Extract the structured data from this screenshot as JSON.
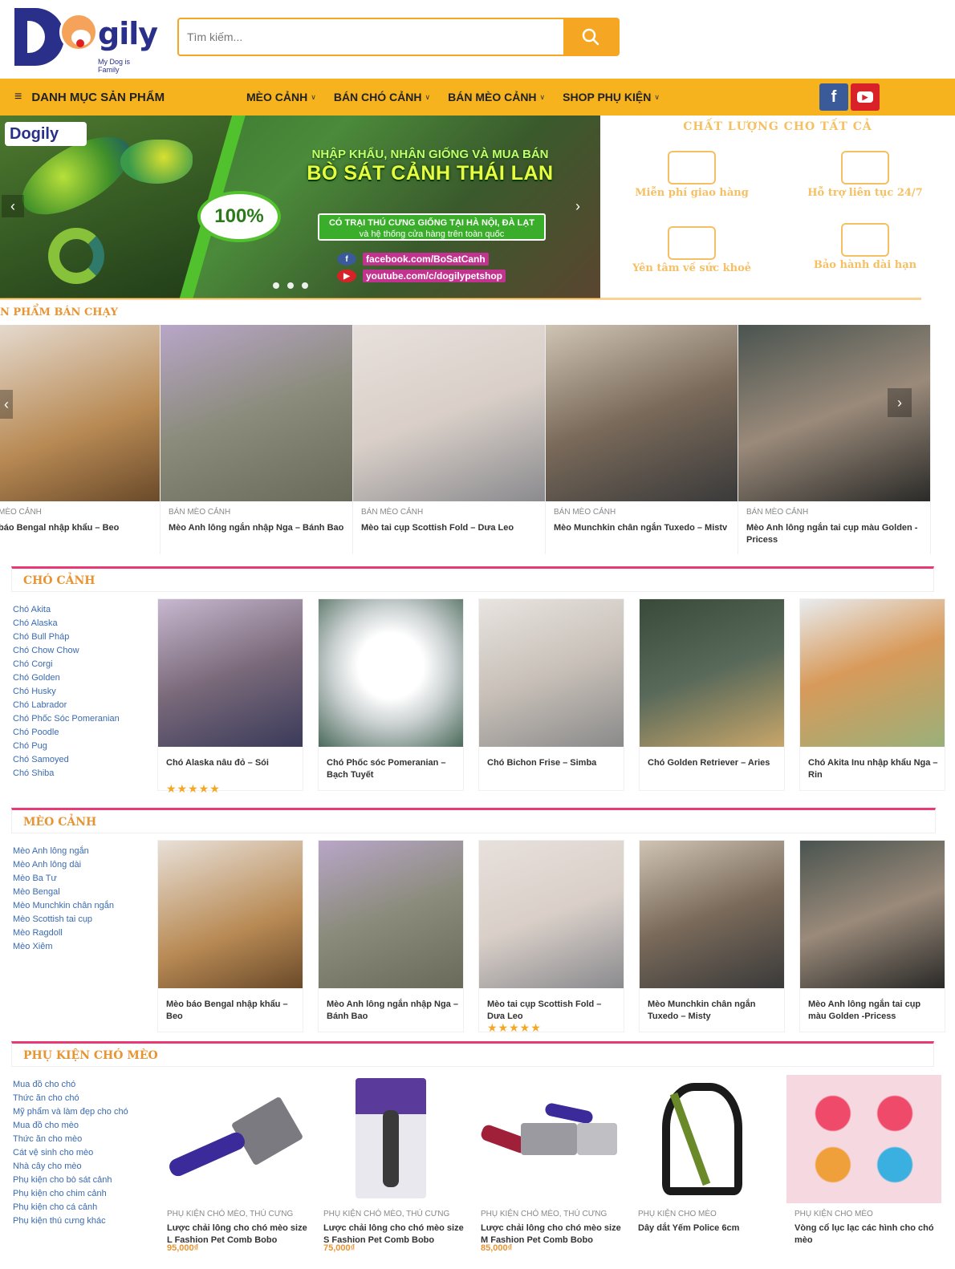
{
  "colors": {
    "accent": "#f7b31e",
    "section_title": "#e89432",
    "section_rule": "#e83a74",
    "link": "#3a6ab0",
    "brand": "#2a2f8a"
  },
  "logo": {
    "word": "gily",
    "tagline": "My Dog is Family"
  },
  "search": {
    "placeholder": "Tìm kiếm...",
    "icon": "search-icon"
  },
  "nav": {
    "category_label": "DANH MỤC SẢN PHẨM",
    "items": [
      {
        "label": "MÈO CẢNH"
      },
      {
        "label": "BÁN CHÓ CẢNH"
      },
      {
        "label": "BÁN MÈO CẢNH"
      },
      {
        "label": "SHOP PHỤ KIỆN"
      }
    ],
    "social": [
      {
        "icon": "facebook-icon",
        "glyph": "f"
      },
      {
        "icon": "youtube-icon",
        "glyph": "▶"
      }
    ]
  },
  "banner": {
    "logo": "Dogily",
    "line1": "NHẬP KHẨU, NHÂN GIỐNG VÀ MUA BÁN",
    "line2": "BÒ SÁT CẢNH THÁI LAN",
    "badge": "100%",
    "box_line1": "CÓ TRẠI THÚ CƯNG GIỐNG TẠI HÀ NỘI, ĐÀ LẠT",
    "box_line2": "và hệ thống cửa hàng trên toàn quốc",
    "facebook": "facebook.com/BoSatCanh",
    "youtube": "youtube.com/c/dogilypetshop",
    "slide_count": 3
  },
  "features": {
    "title": "CHẤT LƯỢNG CHO TẤT CẢ",
    "items": [
      {
        "label": "Miễn phí giao hàng",
        "icon": "rocket-icon"
      },
      {
        "label": "Hỗ trợ liên tục 24/7",
        "icon": "support-agent-icon"
      },
      {
        "label": "Yên tâm về sức khoẻ",
        "icon": "network-icon"
      },
      {
        "label": "Bảo hành dài hạn",
        "icon": "megaphone-icon"
      }
    ]
  },
  "best_sellers": {
    "title": "SẢN PHẨM BÁN CHẠY",
    "title_visible": "N PHẨM BÁN CHẠY",
    "items": [
      {
        "category": "MÈO CẢNH",
        "name": "báo Bengal nhập khẩu – Beo",
        "color": "#b88a54"
      },
      {
        "category": "BÁN MÈO CẢNH",
        "name": "Mèo Anh lông ngắn nhập Nga – Bánh Bao",
        "color": "#8a8b7a"
      },
      {
        "category": "BÁN MÈO CẢNH",
        "name": "Mèo tai cụp Scottish Fold – Dưa Leo",
        "color": "#d9cfc8"
      },
      {
        "category": "BÁN MÈO CẢNH",
        "name": "Mèo Munchkin chân ngắn Tuxedo – Mistv",
        "color": "#7a6a5a"
      },
      {
        "category": "BÁN MÈO CẢNH",
        "name": "Mèo Anh lông ngắn tai cụp màu Golden -Pricess",
        "color": "#9a8a7a"
      }
    ]
  },
  "dogs": {
    "title": "CHÓ CẢNH",
    "links": [
      "Chó Akita",
      "Chó Alaska",
      "Chó Bull Pháp",
      "Chó Chow Chow",
      "Chó Corgi",
      "Chó Golden",
      "Chó Husky",
      "Chó Labrador",
      "Chó Phốc Sóc Pomeranian",
      "Chó Poodle",
      "Chó Pug",
      "Chó Samoyed",
      "Chó Shiba"
    ],
    "products": [
      {
        "name": "Chó Alaska nâu đỏ – Sói",
        "stars": "★★★★★",
        "color": "#7a6a7a"
      },
      {
        "name": "Chó Phốc sóc Pomeranian – Bạch Tuyết",
        "stars": "",
        "color": "#c9cfd0"
      },
      {
        "name": "Chó Bichon Frise – Simba",
        "stars": "",
        "color": "#c8c0b8"
      },
      {
        "name": "Chó Golden Retriever – Aries",
        "stars": "",
        "color": "#5a6a5a"
      },
      {
        "name": "Chó Akita Inu nhập khẩu Nga – Rin",
        "stars": "",
        "color": "#9ab07a"
      }
    ]
  },
  "cats": {
    "title": "MÈO CẢNH",
    "links": [
      "Mèo Anh lông ngắn",
      "Mèo Anh lông dài",
      "Mèo Ba Tư",
      "Mèo Bengal",
      "Mèo Munchkin chân ngắn",
      "Mèo Scottish tai cụp",
      "Mèo Ragdoll",
      "Mèo Xiêm"
    ],
    "products": [
      {
        "name": "Mèo báo Bengal nhập khẩu – Beo",
        "stars": "",
        "color": "#b88a54"
      },
      {
        "name": "Mèo Anh lông ngắn nhập Nga – Bánh Bao",
        "stars": "",
        "color": "#8a8b7a"
      },
      {
        "name": "Mèo tai cụp Scottish Fold – Dưa Leo",
        "stars": "★★★★★",
        "color": "#d9cfc8"
      },
      {
        "name": "Mèo Munchkin chân ngắn Tuxedo – Misty",
        "stars": "",
        "color": "#7a6a5a"
      },
      {
        "name": "Mèo Anh lông ngắn tai cụp màu Golden -Pricess",
        "stars": "",
        "color": "#9a8a7a"
      }
    ]
  },
  "accessories": {
    "title": "PHỤ KIỆN CHÓ MÈO",
    "links": [
      "Mua đồ cho chó",
      "Thức ăn cho chó",
      "Mỹ phẩm và làm đẹp cho chó",
      "Mua đồ cho mèo",
      "Thức ăn cho mèo",
      "Cát vệ sinh cho mèo",
      "Nhà cây cho mèo",
      "Phụ kiện cho bò sát cảnh",
      "Phụ kiện cho chim cảnh",
      "Phụ kiện cho cá cảnh",
      "Phụ kiện thú cưng khác"
    ],
    "products": [
      {
        "category": "PHỤ KIỆN CHÓ MÈO, THÚ CƯNG",
        "name": "Lược chải lông cho chó mèo size L Fashion Pet Comb Bobo",
        "price": "95,000₫",
        "color": "#eceef6"
      },
      {
        "category": "PHỤ KIỆN CHÓ MÈO, THÚ CƯNG",
        "name": "Lược chải lông cho chó mèo size S Fashion Pet Comb Bobo",
        "price": "75,000₫",
        "color": "#ececf2"
      },
      {
        "category": "PHỤ KIỆN CHÓ MÈO, THÚ CƯNG",
        "name": "Lược chải lông cho chó mèo size M Fashion Pet Comb Bobo",
        "price": "85,000₫",
        "color": "#f2f2f4"
      },
      {
        "category": "PHỤ KIỆN CHO MÈO",
        "name": "Dây dắt Yếm Police 6cm",
        "price": "",
        "color": "#f4f4f0"
      },
      {
        "category": "PHỤ KIỆN CHO MÈO",
        "name": "Vòng cổ lục lạc các hình cho chó mèo",
        "price": "",
        "color": "#f6d8e0"
      }
    ]
  }
}
